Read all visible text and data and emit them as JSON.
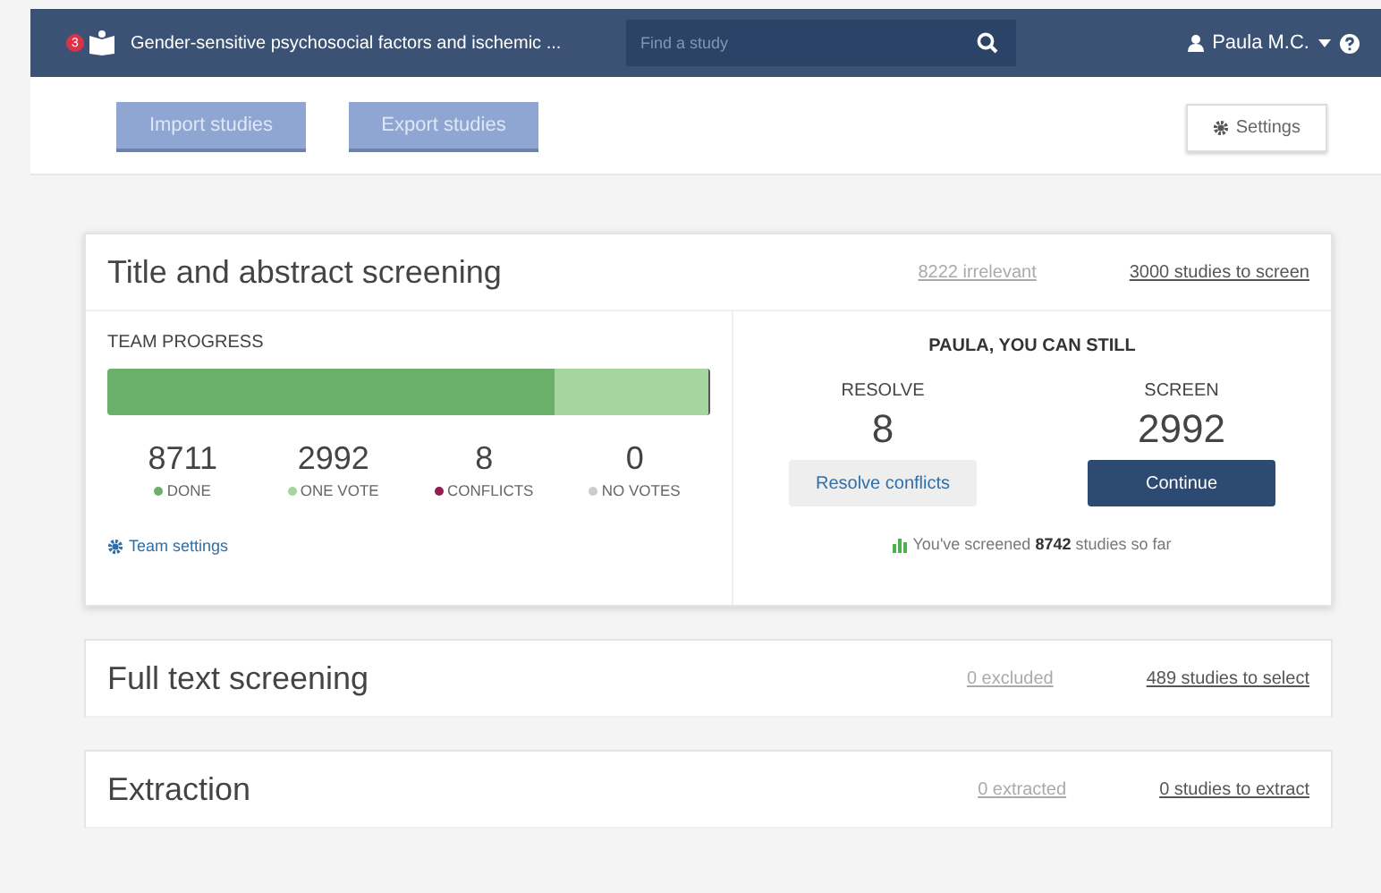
{
  "topbar": {
    "badge": "3",
    "project_title": "Gender-sensitive psychosocial factors and ischemic ...",
    "search": {
      "placeholder": "Find a study"
    },
    "user": "Paula M.C."
  },
  "toolbar": {
    "buttons": [
      "Import studies",
      "Export studies"
    ],
    "settings": "Settings"
  },
  "screening": {
    "title": "Title and abstract screening",
    "links": [
      "8222 irrelevant",
      "3000 studies to screen"
    ],
    "progress_label": "TEAM PROGRESS",
    "segments": [
      {
        "level": 0.744,
        "color": "#6aaf6a"
      },
      {
        "level": 0.256,
        "color": "#a5d6a0"
      }
    ],
    "stats": [
      {
        "value": "8711",
        "label": "DONE",
        "color": "#6aaf6a"
      },
      {
        "value": "2992",
        "label": "ONE VOTE",
        "color": "#a5d6a0"
      },
      {
        "value": "8",
        "label": "CONFLICTS",
        "color": "#8e1f4f"
      },
      {
        "value": "0",
        "label": "NO VOTES",
        "color": "#cccccc"
      }
    ],
    "team_settings": "Team settings",
    "you_heading": "PAULA, YOU CAN STILL",
    "actions": [
      {
        "label": "RESOLVE",
        "value": "8",
        "button": "Resolve conflicts",
        "kind": "secondary"
      },
      {
        "label": "SCREEN",
        "value": "2992",
        "button": "Continue",
        "kind": "primary"
      }
    ],
    "summary": "You've screened **8742** studies so far"
  },
  "stages": [
    {
      "title": "Full text screening",
      "links": [
        "0 excluded",
        "489 studies to select"
      ]
    },
    {
      "title": "Extraction",
      "links": [
        "0 extracted",
        "0 studies to extract"
      ]
    }
  ]
}
